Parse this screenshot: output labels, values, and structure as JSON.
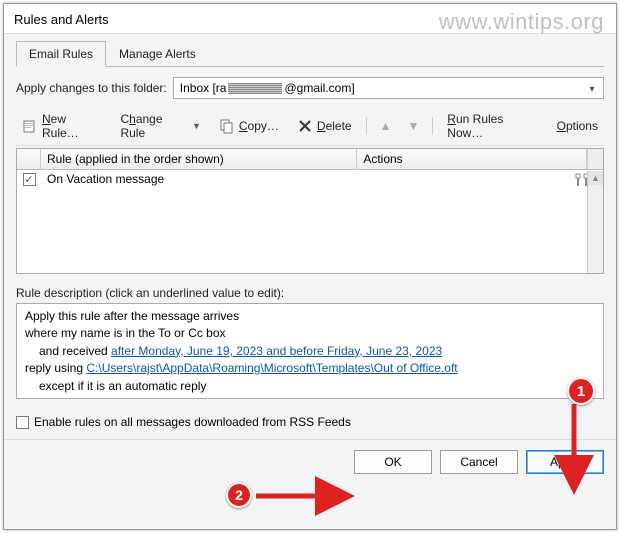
{
  "window": {
    "title": "Rules and Alerts"
  },
  "watermark": "www.wintips.org",
  "tabs": {
    "email_rules": "Email Rules",
    "manage_alerts": "Manage Alerts"
  },
  "folder": {
    "label": "Apply changes to this folder:",
    "value_prefix": "Inbox [ra",
    "value_suffix": "@gmail.com]"
  },
  "toolbar": {
    "new_rule": "New Rule…",
    "change_rule": "Change Rule",
    "copy": "Copy…",
    "delete": "Delete",
    "run_now": "Run Rules Now…",
    "options": "Options"
  },
  "grid": {
    "col_rule": "Rule (applied in the order shown)",
    "col_actions": "Actions",
    "rows": [
      {
        "checked": true,
        "name": "On Vacation message"
      }
    ]
  },
  "description": {
    "label": "Rule description (click an underlined value to edit):",
    "line1": "Apply this rule after the message arrives",
    "line2": "where my name is in the To or Cc box",
    "line3_a": "and received ",
    "line3_link": "after Monday, June 19, 2023 and before Friday, June 23, 2023",
    "line4_a": "reply using ",
    "line4_link": "C:\\Users\\rajst\\AppData\\Roaming\\Microsoft\\Templates\\Out of Office.oft",
    "line5": "except if it is an automatic reply"
  },
  "rss": {
    "label": "Enable rules on all messages downloaded from RSS Feeds"
  },
  "buttons": {
    "ok": "OK",
    "cancel": "Cancel",
    "apply": "Apply"
  },
  "annotations": {
    "n1": "1",
    "n2": "2"
  }
}
